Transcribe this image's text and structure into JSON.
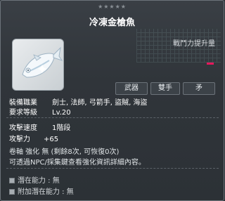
{
  "header": {
    "stars": "★★★★★",
    "item_name": "冷凍金槍魚"
  },
  "combat_power": {
    "label": "戰鬥力提升量",
    "bar_color": "#e6185c"
  },
  "tags": [
    "武器",
    "雙手",
    "矛"
  ],
  "requirements": {
    "job_label": "裝備職業",
    "job_value": "劍士, 法師, 弓箭手, 盜賊, 海盜",
    "level_label": "要求等級",
    "level_value": "Lv.20"
  },
  "stats": {
    "speed_label": "攻擊速度",
    "speed_value": "1階段",
    "attack_label": "攻擊力",
    "attack_value": "+65"
  },
  "upgrade": {
    "line1": "卷軸 強化 無 (剩餘8次, 可恢復0次)",
    "line2": "可透過NPC/採集鍵查看強化資訊詳細內容。"
  },
  "potential": {
    "line1": "潛在能力 : 無",
    "line2": "附加潛在能力 : 無"
  },
  "icon": {
    "name": "frozen-tuna-icon"
  }
}
